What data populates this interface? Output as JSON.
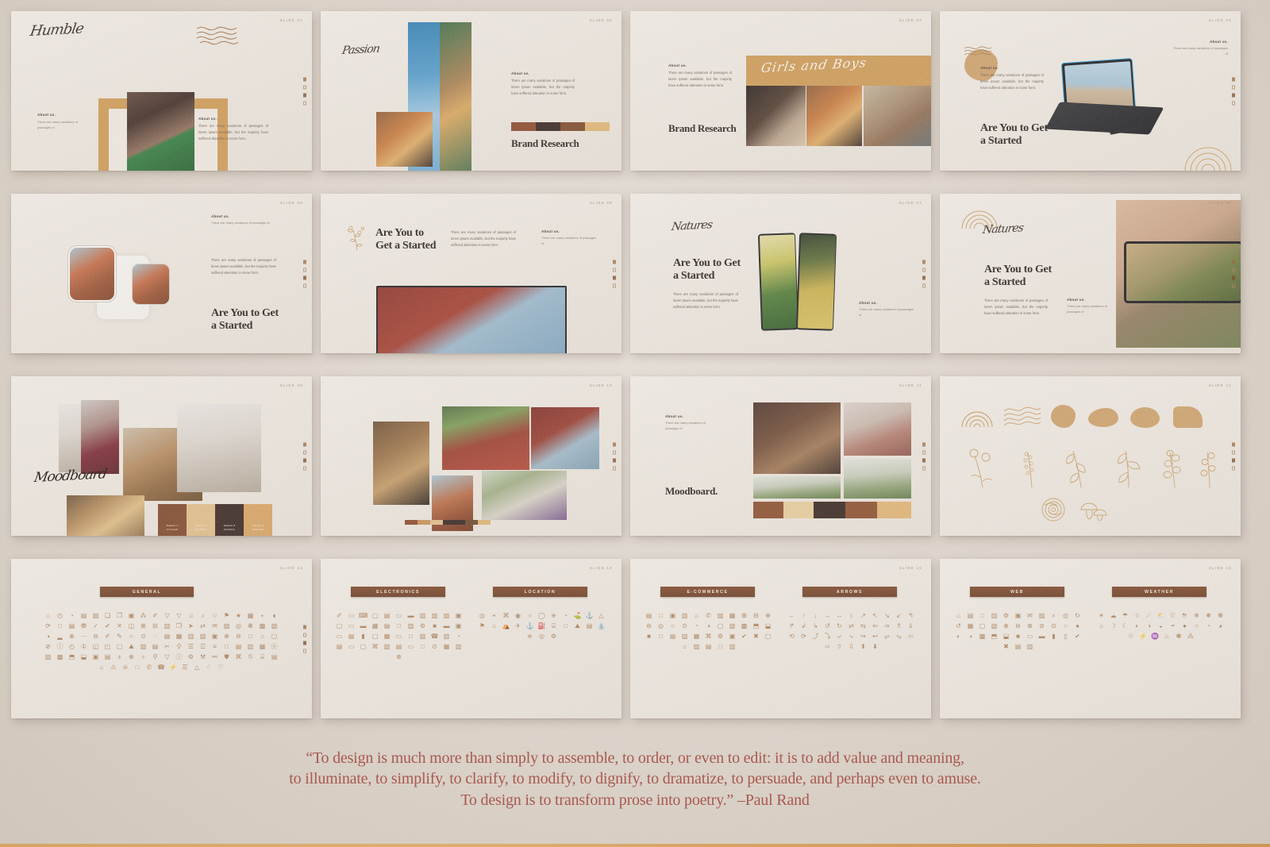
{
  "page": {
    "quote_lines": [
      "“To design is much more than simply to assemble, to order, or even to edit: it is to add value and meaning,",
      "to illuminate, to simplify, to clarify, to modify, to dignify, to dramatize, to persuade, and perhaps even to amuse.",
      "To design is to transform prose into poetry.” –Paul Rand"
    ],
    "accent_color": "#a8544a",
    "brand_tan": "#cfa169",
    "brand_brown": "#7d4526"
  },
  "common": {
    "about_heading": "About us.",
    "about_body": "There are many variations of passages of lorem ipsum available, but the majority have suffered alteration in some form.",
    "about_body_short": "There are many variations of passages of",
    "headline_started": "Are You to Get a Started",
    "headline_brand_research": "Brand Research"
  },
  "slides": [
    {
      "num": "Slide 01",
      "kind": "humble",
      "script_title": "Humble"
    },
    {
      "num": "Slide 02",
      "kind": "passion",
      "script_title": "Passion",
      "headline": "Brand Research"
    },
    {
      "num": "Slide 03",
      "kind": "girlsboys",
      "script_title": "Girls and Boys",
      "headline": "Brand Research"
    },
    {
      "num": "Slide 04",
      "kind": "tablet",
      "headline": "Are You to Get a Started"
    },
    {
      "num": "Slide 05",
      "kind": "watch",
      "headline": "Are You to Get a Started"
    },
    {
      "num": "Slide 06",
      "kind": "laptop",
      "headline": "Are You to Get a Started"
    },
    {
      "num": "Slide 07",
      "kind": "natures-a",
      "script_title": "Natures",
      "headline": "Are You to Get a Started"
    },
    {
      "num": "Slide 08",
      "kind": "natures-b",
      "script_title": "Natures",
      "headline": "Are You to Get a Started"
    },
    {
      "num": "Slide 09",
      "kind": "moodboard-script",
      "script_title": "Moodboard"
    },
    {
      "num": "Slide 10",
      "kind": "collage"
    },
    {
      "num": "Slide 11",
      "kind": "moodboard-serif",
      "headline": "Moodboard."
    },
    {
      "num": "Slide 12",
      "kind": "elements"
    },
    {
      "num": "Slide 13",
      "kind": "icons",
      "badges": [
        "GENERAL"
      ]
    },
    {
      "num": "Slide 14",
      "kind": "icons",
      "badges": [
        "ELECTRONICS",
        "LOCATION"
      ]
    },
    {
      "num": "Slide 15",
      "kind": "icons",
      "badges": [
        "E-COMMERCE",
        "ARROWS"
      ]
    },
    {
      "num": "Slide 16",
      "kind": "icons",
      "badges": [
        "WEB",
        "WEATHER"
      ]
    }
  ],
  "palette": {
    "swatches": [
      {
        "name": "Colour 1",
        "code": "#7C4426",
        "hex": "#7C4426"
      },
      {
        "name": "Colour 2",
        "code": "#E3BE88",
        "hex": "#E3BE88"
      },
      {
        "name": "Colour 3",
        "code": "#33201A",
        "hex": "#33201A"
      },
      {
        "name": "Colour 4",
        "code": "#D9A360",
        "hex": "#D9A360"
      }
    ],
    "bar_slide11": [
      "#8A4B28",
      "#E9CE9B",
      "#32201A",
      "#8A4B28",
      "#E3B472"
    ],
    "bar_slide02": [
      "#8A4526",
      "#32201A",
      "#7C4426",
      "#E3B472"
    ],
    "bar_slide10": [
      "#8A4526",
      "#C98F52",
      "#E3BE88",
      "#32201A",
      "#6B4228",
      "#E3B472"
    ]
  },
  "icons": {
    "general": [
      "⌂",
      "◴",
      "◔",
      "▤",
      "▧",
      "❑",
      "❐",
      "▣",
      "⁂",
      "✐",
      "▽",
      "▽",
      "♫",
      "♪",
      "☆",
      "⚑",
      "★",
      "▦",
      "⬩",
      "⬧",
      "⟳",
      "□",
      "▤",
      "⛃",
      "✓",
      "✔",
      "✕",
      "◫",
      "⊞",
      "⊟",
      "▥",
      "❐",
      "➤",
      "⇄",
      "✉",
      "▨",
      "◎",
      "☸",
      "▩",
      "▧",
      "◑",
      "▂",
      "⊕",
      "⋯",
      "⊖",
      "✐",
      "✎",
      "○",
      "⊙",
      "◌",
      "▤",
      "▦",
      "▥",
      "▨",
      "▣",
      "⊕",
      "⊖",
      "□",
      "⌂",
      "▢",
      "⊘",
      "ⓘ",
      "◴",
      "①",
      "◱",
      "◰",
      "▢",
      "⛰",
      "▧",
      "▤",
      "✂",
      "⚲",
      "☰",
      "☲",
      "≡",
      "□",
      "▤",
      "▥",
      "▦",
      "ⓞ",
      "▨",
      "▩",
      "⬒",
      "⬓",
      "▣",
      "▤",
      "⌽",
      "⊕",
      "⌕",
      "⚲",
      "▽",
      "ⓘ",
      "⚙",
      "⚒",
      "⚯",
      "⛊",
      "⌘",
      "⍉",
      "⌸",
      "▤",
      "⌂",
      "⚠",
      "☠",
      "□",
      "✆",
      "☎",
      "⚡",
      "☰",
      "△",
      "♢",
      "♡"
    ],
    "electronics": [
      "✐",
      "▭",
      "⌨",
      "▢",
      "▤",
      "▭",
      "▬",
      "▥",
      "▧",
      "▨",
      "▣",
      "▢",
      "▭",
      "▬",
      "▦",
      "▤",
      "□",
      "▥",
      "⚙",
      "■",
      "▬",
      "▣",
      "▭",
      "▤",
      "▮",
      "▢",
      "▦",
      "▭",
      "□",
      "▨",
      "☎",
      "▥",
      "◔",
      "▤",
      "▭",
      "▢",
      "⌘",
      "▧",
      "▤",
      "▭",
      "□",
      "⊙",
      "▦",
      "▥",
      "⊗"
    ],
    "location": [
      "◎",
      "⌖",
      "⌘",
      "◉",
      "○",
      "◯",
      "⎈",
      "◔",
      "⛳",
      "⚓",
      "△",
      "⚑",
      "⌂",
      "⛺",
      "✈",
      "⚓",
      "⛽",
      "⌸",
      "□",
      "⛰",
      "▤",
      "⛲",
      "⎈",
      "◎",
      "⚙"
    ],
    "ecommerce": [
      "▤",
      "□",
      "▣",
      "▥",
      "⌂",
      "✆",
      "▨",
      "▦",
      "⊞",
      "⊟",
      "⊕",
      "⊖",
      "◎",
      "○",
      "⊙",
      "◔",
      "◑",
      "▢",
      "▧",
      "▩",
      "⬒",
      "⬓",
      "■",
      "□",
      "▤",
      "▥",
      "▦",
      "⌘",
      "⚙",
      "▣",
      "✔",
      "✖",
      "▢",
      "⌂",
      "▨",
      "▤",
      "□",
      "▥"
    ],
    "arrows": [
      "←",
      "↑",
      "↓",
      "→",
      "↔",
      "↕",
      "↗",
      "↖",
      "↘",
      "↙",
      "↰",
      "↱",
      "↲",
      "↳",
      "↺",
      "↻",
      "⇄",
      "⇆",
      "⇐",
      "⇒",
      "⇑",
      "⇓",
      "⟲",
      "⟳",
      "⤴",
      "⤵",
      "⤶",
      "⤷",
      "↪",
      "↩",
      "⥂",
      "⥃",
      "⇦",
      "⇨",
      "⇧",
      "⇩",
      "⬆",
      "⬇"
    ],
    "web": [
      "⌂",
      "▤",
      "□",
      "▥",
      "⚙",
      "▣",
      "✉",
      "▨",
      "⌕",
      "◎",
      "↻",
      "↺",
      "▦",
      "▢",
      "▧",
      "⊕",
      "⊖",
      "⊗",
      "⊘",
      "⊙",
      "○",
      "●",
      "◐",
      "◑",
      "▩",
      "⬒",
      "⬓",
      "■",
      "▭",
      "▬",
      "▮",
      "▯",
      "✔",
      "✖",
      "▤",
      "▥"
    ],
    "weather": [
      "☀",
      "☁",
      "☂",
      "☃",
      "☄",
      "⛅",
      "⛆",
      "⛈",
      "❄",
      "❅",
      "❆",
      "☼",
      "☽",
      "☾",
      "◐",
      "◑",
      "◒",
      "◓",
      "●",
      "○",
      "◔",
      "◕",
      "☉",
      "⚡",
      "♒",
      "♨",
      "✽",
      "⁂"
    ]
  }
}
